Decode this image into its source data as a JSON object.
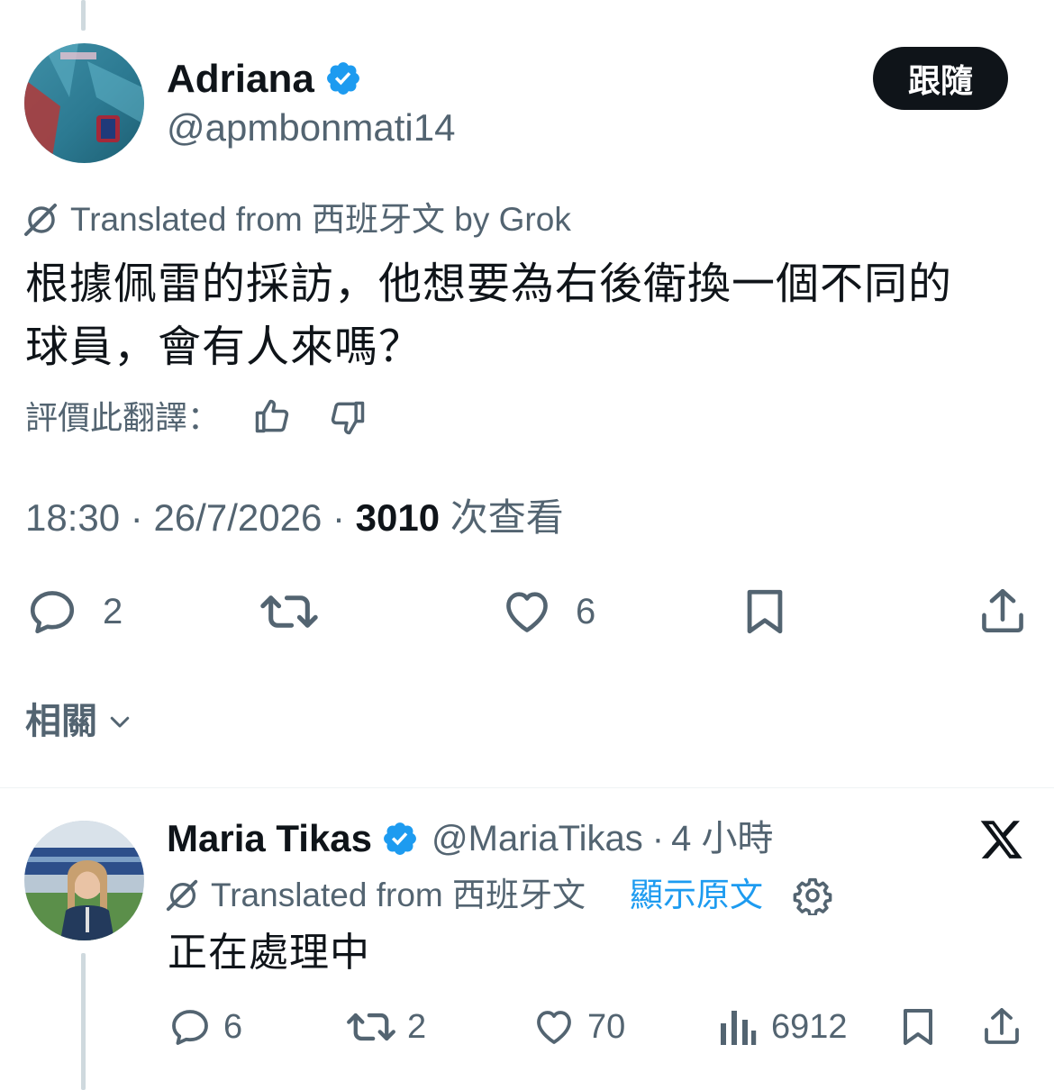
{
  "tweet": {
    "author_name": "Adriana",
    "author_handle": "@apmbonmati14",
    "follow_label": "跟隨",
    "translation_note": "Translated from 西班牙文 by Grok",
    "text_line1": "根據佩雷的採訪，他想要為右後衛換一個不同的",
    "text_line2": "球員，會有人來嗎？",
    "rate_label": "評價此翻譯：",
    "time": "18:30",
    "separator": "·",
    "date": "26/7/2026",
    "views_count": "3010",
    "views_label": "次查看",
    "actions": {
      "reply_count": "2",
      "retweet_count": "",
      "like_count": "6"
    }
  },
  "related": {
    "label": "相關"
  },
  "reply": {
    "author_name": "Maria Tikas",
    "author_handle": "@MariaTikas",
    "separator": "·",
    "time_ago": "4 小時",
    "translation_note": "Translated from 西班牙文",
    "show_original": "顯示原文",
    "text": "正在處理中",
    "actions": {
      "reply_count": "6",
      "retweet_count": "2",
      "like_count": "70",
      "view_count": "6912"
    }
  },
  "colors": {
    "text": "#0f1419",
    "muted": "#536471",
    "link": "#1d9bf0",
    "verified": "#1d9bf0",
    "thread_line": "#cfd9de"
  }
}
